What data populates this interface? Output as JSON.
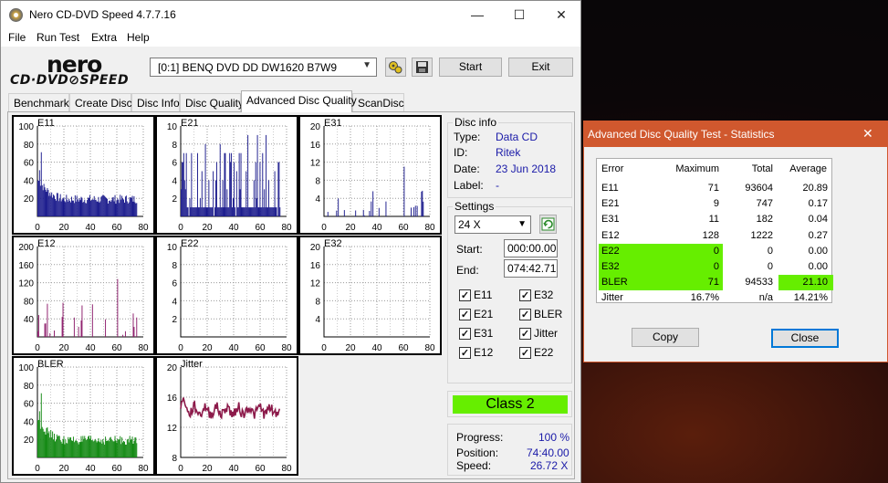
{
  "main_window": {
    "title": "Nero CD-DVD Speed 4.7.7.16",
    "controls": {
      "minimize": "—",
      "maximize": "☐",
      "close": "✕"
    },
    "menu": [
      "File",
      "Run Test",
      "Extra",
      "Help"
    ],
    "logo": {
      "brand": "nero",
      "product": "CD·DVD⊘SPEED"
    },
    "drive": "[0:1]   BENQ DVD DD DW1620 B7W9",
    "start_label": "Start",
    "exit_label": "Exit",
    "tabs": [
      "Benchmark",
      "Create Disc",
      "Disc Info",
      "Disc Quality",
      "Advanced Disc Quality",
      "ScanDisc"
    ],
    "active_tab": "Advanced Disc Quality"
  },
  "disc_info": {
    "heading": "Disc info",
    "type_label": "Type:",
    "type_value": "Data CD",
    "id_label": "ID:",
    "id_value": "Ritek",
    "date_label": "Date:",
    "date_value": "23 Jun 2018",
    "label_label": "Label:",
    "label_value": "-"
  },
  "settings": {
    "heading": "Settings",
    "speed": "24 X",
    "start_label": "Start:",
    "start_value": "000:00.00",
    "end_label": "End:",
    "end_value": "074:42.71",
    "checkboxes": [
      {
        "label": "E11",
        "checked": true
      },
      {
        "label": "E32",
        "checked": true
      },
      {
        "label": "E21",
        "checked": true
      },
      {
        "label": "BLER",
        "checked": true
      },
      {
        "label": "E31",
        "checked": true
      },
      {
        "label": "Jitter",
        "checked": true
      },
      {
        "label": "E12",
        "checked": true
      },
      {
        "label": "E22",
        "checked": true
      }
    ]
  },
  "class_label": "Class 2",
  "progress": {
    "progress_label": "Progress:",
    "progress_value": "100 %",
    "position_label": "Position:",
    "position_value": "74:40.00",
    "speed_label": "Speed:",
    "speed_value": "26.72 X"
  },
  "stats_window": {
    "title": "Advanced Disc Quality Test - Statistics",
    "close": "✕",
    "columns": [
      "Error",
      "Maximum",
      "Total",
      "Average"
    ],
    "rows": [
      [
        "E11",
        "71",
        "93604",
        "20.89"
      ],
      [
        "E21",
        "9",
        "747",
        "0.17"
      ],
      [
        "E31",
        "11",
        "182",
        "0.04"
      ],
      [
        "E12",
        "128",
        "1222",
        "0.27"
      ],
      [
        "E22",
        "0",
        "0",
        "0.00"
      ],
      [
        "E32",
        "0",
        "0",
        "0.00"
      ],
      [
        "BLER",
        "71",
        "94533",
        "21.10"
      ],
      [
        "Jitter",
        "16.7%",
        "n/a",
        "14.21%"
      ]
    ],
    "copy_label": "Copy",
    "close_label": "Close",
    "highlight_green": "#66ee00"
  },
  "chart_data": [
    {
      "name": "E11",
      "type": "bar",
      "color": "#1a1a8c",
      "xlim": [
        0,
        80
      ],
      "ylim": [
        0,
        100
      ],
      "yticks": [
        20,
        40,
        60,
        80,
        100
      ],
      "xticks": [
        0,
        20,
        40,
        60,
        80
      ],
      "x_end": 74.7,
      "profile": "decay",
      "peak": 71,
      "base": 18
    },
    {
      "name": "E21",
      "type": "bar",
      "color": "#1a1a8c",
      "xlim": [
        0,
        80
      ],
      "ylim": [
        0,
        10
      ],
      "yticks": [
        2,
        4,
        6,
        8,
        10
      ],
      "xticks": [
        0,
        20,
        40,
        60,
        80
      ],
      "x_end": 74.7,
      "profile": "spiky",
      "peak": 9,
      "base": 1
    },
    {
      "name": "E31",
      "type": "bar",
      "color": "#1a1a8c",
      "xlim": [
        0,
        80
      ],
      "ylim": [
        0,
        20
      ],
      "yticks": [
        4,
        8,
        12,
        16,
        20
      ],
      "xticks": [
        0,
        20,
        40,
        60,
        80
      ],
      "x_end": 74.7,
      "profile": "sparse",
      "peak": 11,
      "base": 0
    },
    {
      "name": "E12",
      "type": "bar",
      "color": "#8c1a6a",
      "xlim": [
        0,
        80
      ],
      "ylim": [
        0,
        200
      ],
      "yticks": [
        40,
        80,
        120,
        160,
        200
      ],
      "xticks": [
        0,
        20,
        40,
        60,
        80
      ],
      "x_end": 74.7,
      "profile": "sparse",
      "peak": 128,
      "base": 0
    },
    {
      "name": "E22",
      "type": "bar",
      "color": "#8c1a6a",
      "xlim": [
        0,
        80
      ],
      "ylim": [
        0,
        10
      ],
      "yticks": [
        2,
        4,
        6,
        8,
        10
      ],
      "xticks": [
        0,
        20,
        40,
        60,
        80
      ],
      "x_end": 74.7,
      "profile": "zero",
      "peak": 0,
      "base": 0
    },
    {
      "name": "E32",
      "type": "bar",
      "color": "#8c1a6a",
      "xlim": [
        0,
        80
      ],
      "ylim": [
        0,
        20
      ],
      "yticks": [
        4,
        8,
        12,
        16,
        20
      ],
      "xticks": [
        0,
        20,
        40,
        60,
        80
      ],
      "x_end": 74.7,
      "profile": "zero",
      "peak": 0,
      "base": 0
    },
    {
      "name": "BLER",
      "type": "bar",
      "color": "#118811",
      "xlim": [
        0,
        80
      ],
      "ylim": [
        0,
        100
      ],
      "yticks": [
        20,
        40,
        60,
        80,
        100
      ],
      "xticks": [
        0,
        20,
        40,
        60,
        80
      ],
      "x_end": 74.7,
      "profile": "decay",
      "peak": 71,
      "base": 18
    },
    {
      "name": "Jitter",
      "type": "line",
      "color": "#8c1a4a",
      "xlim": [
        0,
        80
      ],
      "ylim": [
        8,
        20
      ],
      "yticks": [
        8,
        12,
        16,
        20
      ],
      "xticks": [
        0,
        20,
        40,
        60,
        80
      ],
      "x_end": 74.7,
      "profile": "jitter",
      "peak": 16.7,
      "base": 14.2
    }
  ]
}
